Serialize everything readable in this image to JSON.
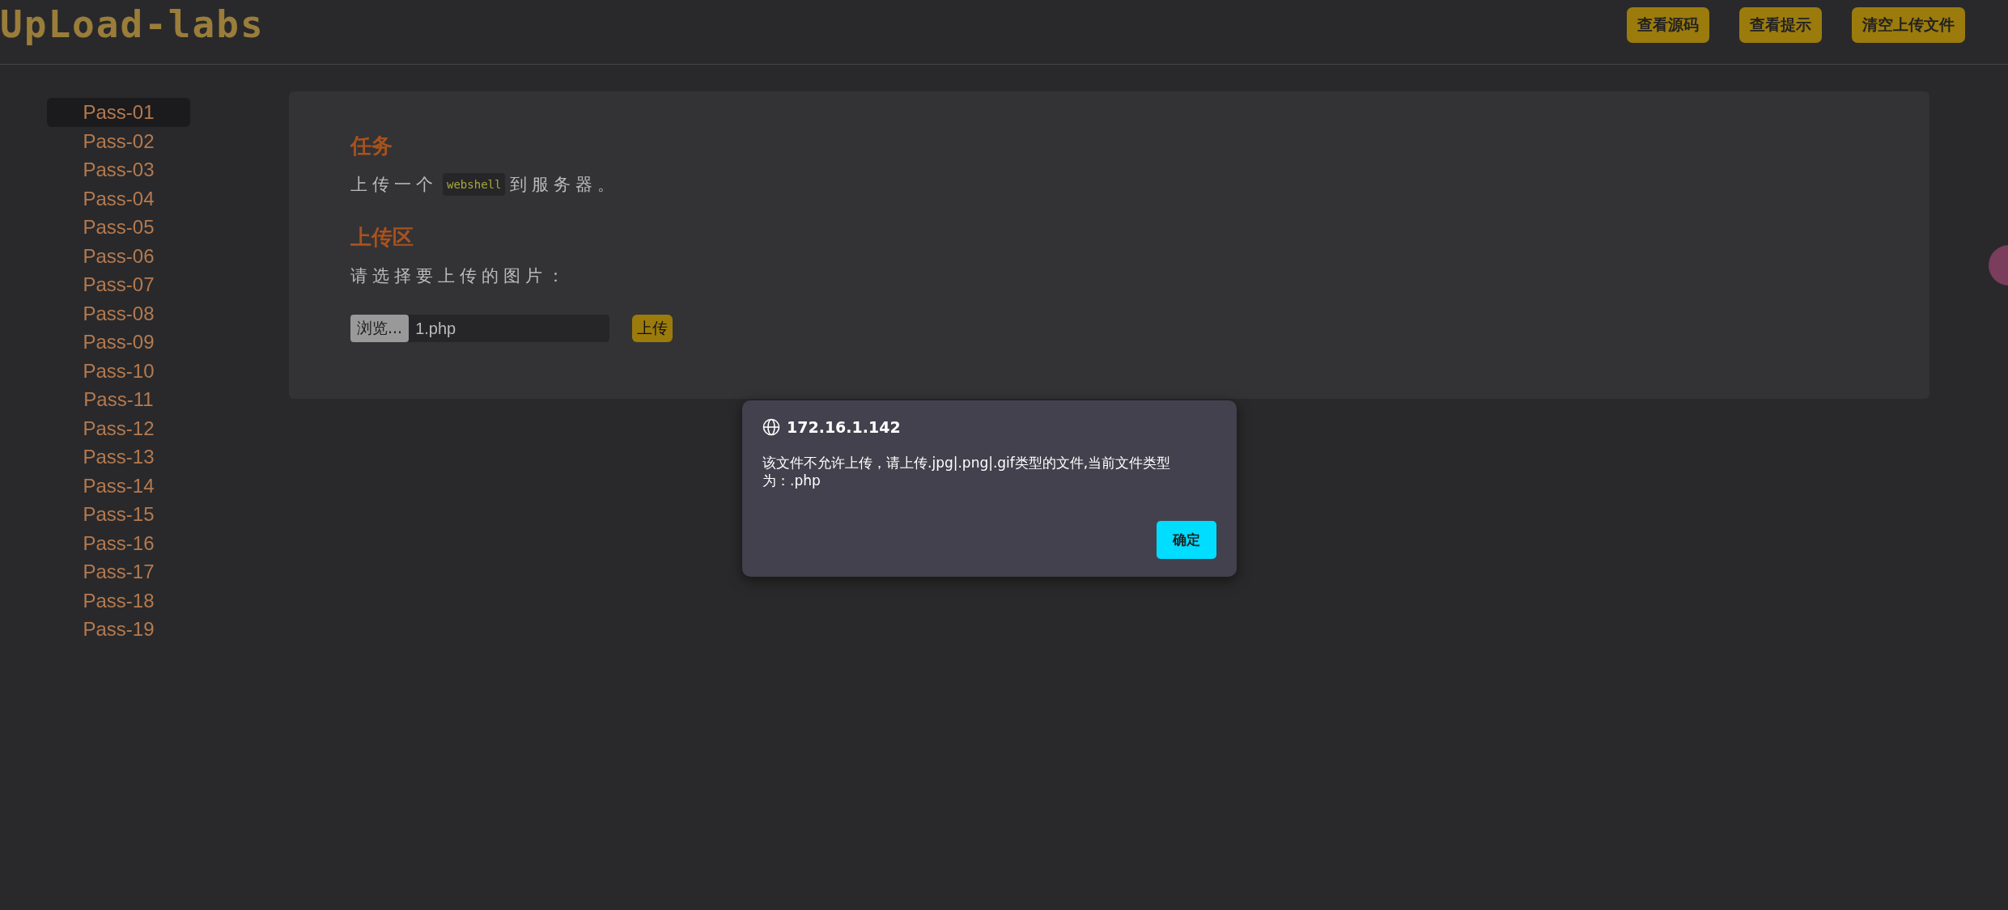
{
  "header": {
    "logo": "UpLoad-labs",
    "buttons": [
      "查看源码",
      "查看提示",
      "清空上传文件"
    ]
  },
  "sidebar": {
    "items": [
      {
        "label": "Pass-01",
        "selected": true
      },
      {
        "label": "Pass-02",
        "selected": false
      },
      {
        "label": "Pass-03",
        "selected": false
      },
      {
        "label": "Pass-04",
        "selected": false
      },
      {
        "label": "Pass-05",
        "selected": false
      },
      {
        "label": "Pass-06",
        "selected": false
      },
      {
        "label": "Pass-07",
        "selected": false
      },
      {
        "label": "Pass-08",
        "selected": false
      },
      {
        "label": "Pass-09",
        "selected": false
      },
      {
        "label": "Pass-10",
        "selected": false
      },
      {
        "label": "Pass-11",
        "selected": false
      },
      {
        "label": "Pass-12",
        "selected": false
      },
      {
        "label": "Pass-13",
        "selected": false
      },
      {
        "label": "Pass-14",
        "selected": false
      },
      {
        "label": "Pass-15",
        "selected": false
      },
      {
        "label": "Pass-16",
        "selected": false
      },
      {
        "label": "Pass-17",
        "selected": false
      },
      {
        "label": "Pass-18",
        "selected": false
      },
      {
        "label": "Pass-19",
        "selected": false
      }
    ]
  },
  "panel": {
    "task_heading": "任务",
    "task_before": "上传一个",
    "task_code": "webshell",
    "task_after": "到服务器。",
    "upload_heading": "上传区",
    "prompt": "请选择要上传的图片：",
    "browse_button": "浏览...",
    "file_name": "1.php",
    "upload_button": "上传"
  },
  "dialog": {
    "origin": "172.16.1.142",
    "message": "该文件不允许上传，请上传.jpg|.png|.gif类型的文件,当前文件类型为：.php",
    "ok_button": "确定"
  }
}
